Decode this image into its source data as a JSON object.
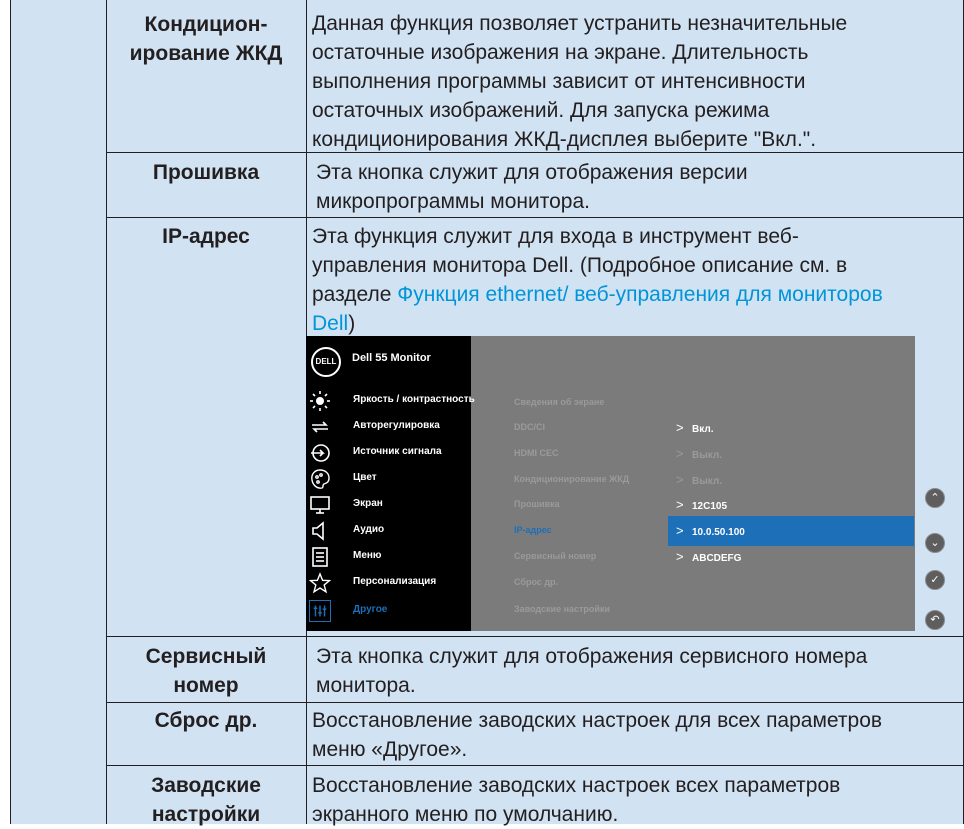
{
  "rows": [
    {
      "label_lines": [
        "Кондицион-",
        "ирование ЖКД"
      ],
      "desc_lines": [
        "Данная функция позволяет устранить незначительные",
        "остаточные изображения на экране. Длительность",
        "выполнения программы зависит от интенсивности",
        "остаточных изображений. Для запуска режима",
        "кондиционирования ЖКД-дисплея выберите \"Вкл.\"."
      ]
    },
    {
      "label_lines": [
        "Прошивка"
      ],
      "desc_lines": [
        "Эта кнопка служит для отображения версии",
        "микропрограммы монитора."
      ]
    },
    {
      "label_lines": [
        "IP-адрес"
      ],
      "desc_lines": [
        "Эта функция служит для входа в инструмент веб-",
        "управления монитора Dell. (Подробное описание см. в",
        "разделе "
      ],
      "link_lines": [
        "Функция ethernet/ веб-управления для мониторов",
        "Dell"
      ],
      "after_link": ")"
    },
    {
      "label_lines": [
        "Сервисный",
        "номер"
      ],
      "desc_lines": [
        "Эта кнопка служит для отображения сервисного номера",
        "монитора."
      ]
    },
    {
      "label_lines": [
        "Сброс др."
      ],
      "desc_lines": [
        "Восстановление заводских настроек для всех параметров",
        "меню «Другое»."
      ]
    },
    {
      "label_lines": [
        "Заводские",
        "настройки"
      ],
      "desc_lines": [
        "Восстановление заводских настроек всех параметров",
        "экранного меню по умолчанию."
      ]
    }
  ],
  "osd": {
    "logo": "DELL",
    "title": "Dell 55 Monitor",
    "menu": [
      {
        "label": "Яркость / контрастность",
        "icon": "brightness-icon"
      },
      {
        "label": "Авторегулировка",
        "icon": "auto-adjust-icon"
      },
      {
        "label": "Источник сигнала",
        "icon": "input-source-icon"
      },
      {
        "label": "Цвет",
        "icon": "color-icon"
      },
      {
        "label": "Экран",
        "icon": "display-icon"
      },
      {
        "label": "Аудио",
        "icon": "audio-icon"
      },
      {
        "label": "Меню",
        "icon": "menu-icon"
      },
      {
        "label": "Персонализация",
        "icon": "star-icon"
      },
      {
        "label": "Другое",
        "icon": "other-icon",
        "active": true
      }
    ],
    "submenu": [
      {
        "label": "Сведения об экране",
        "value": ""
      },
      {
        "label": "DDC/CI",
        "value": "Вкл."
      },
      {
        "label": "HDMI CEC",
        "value": "Выкл."
      },
      {
        "label": "Кондиционирование ЖКД",
        "value": "Выкл."
      },
      {
        "label": "Прошивка",
        "value": "12C105"
      },
      {
        "label": "IP-адрес",
        "value": "10.0.50.100",
        "selected": true
      },
      {
        "label": "Сервисный номер",
        "value": "ABCDEFG"
      },
      {
        "label": "Сброс др.",
        "value": ""
      },
      {
        "label": "Заводские настройки",
        "value": ""
      }
    ],
    "chevron": ">",
    "nav": [
      {
        "name": "up-icon",
        "glyph": "⌃"
      },
      {
        "name": "down-icon",
        "glyph": "⌄"
      },
      {
        "name": "check-icon",
        "glyph": "✓"
      },
      {
        "name": "back-icon",
        "glyph": "↶"
      }
    ]
  }
}
